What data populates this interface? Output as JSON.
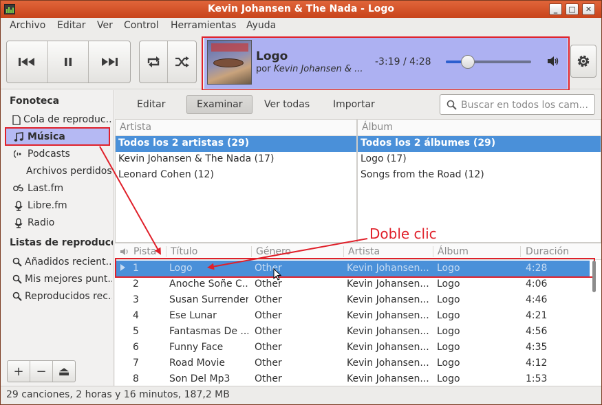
{
  "window": {
    "title": "Kevin Johansen & The Nada - Logo",
    "controls": [
      "_",
      "□",
      "✕"
    ]
  },
  "menu": [
    "Archivo",
    "Editar",
    "Ver",
    "Control",
    "Herramientas",
    "Ayuda"
  ],
  "now_playing": {
    "title": "Logo",
    "by_prefix": "por",
    "artist": "Kevin Johansen & ...",
    "time": "-3:19 / 4:28",
    "progress_fraction": 0.26
  },
  "sidebar": {
    "library_header": "Fonoteca",
    "items": [
      {
        "label": "Cola de reproduc...",
        "icon": "document-icon"
      },
      {
        "label": "Música",
        "icon": "music-note-icon",
        "selected": true
      },
      {
        "label": "Podcasts",
        "icon": "podcast-icon"
      },
      {
        "label": "Archivos perdidos",
        "icon": ""
      },
      {
        "label": "Last.fm",
        "icon": "lastfm-icon"
      },
      {
        "label": "Libre.fm",
        "icon": "librefm-icon"
      },
      {
        "label": "Radio",
        "icon": "radio-icon"
      }
    ],
    "playlists_header": "Listas de reproducció",
    "playlists": [
      {
        "label": "Añadidos recient...",
        "icon": "search-icon"
      },
      {
        "label": "Mis mejores punt...",
        "icon": "search-icon"
      },
      {
        "label": "Reproducidos rec...",
        "icon": "search-icon"
      }
    ],
    "bottom_buttons": [
      "+",
      "−",
      "⏏"
    ]
  },
  "browser": {
    "tabs": [
      "Editar",
      "Examinar",
      "Ver todas",
      "Importar"
    ],
    "active_tab": "Examinar",
    "search_placeholder": "Buscar en todos los cam...",
    "artist_header": "Artista",
    "artists": [
      "Todos los 2 artistas (29)",
      "Kevin Johansen & The Nada (17)",
      "Leonard Cohen (12)"
    ],
    "album_header": "Álbum",
    "albums": [
      "Todos los 2 álbumes (29)",
      "Logo (17)",
      "Songs from the Road (12)"
    ]
  },
  "tracks": {
    "columns": [
      "Pista",
      "Título",
      "Género",
      "Artista",
      "Álbum",
      "Duración"
    ],
    "rows": [
      {
        "track": "1",
        "title": "Logo",
        "genre": "Other",
        "artist": "Kevin Johansen...",
        "album": "Logo",
        "duration": "4:28",
        "playing": true
      },
      {
        "track": "2",
        "title": "Anoche Soñe C...",
        "genre": "Other",
        "artist": "Kevin Johansen...",
        "album": "Logo",
        "duration": "4:06"
      },
      {
        "track": "3",
        "title": "Susan Surrender",
        "genre": "Other",
        "artist": "Kevin Johansen...",
        "album": "Logo",
        "duration": "4:46"
      },
      {
        "track": "4",
        "title": "Ese Lunar",
        "genre": "Other",
        "artist": "Kevin Johansen...",
        "album": "Logo",
        "duration": "4:21"
      },
      {
        "track": "5",
        "title": "Fantasmas De ...",
        "genre": "Other",
        "artist": "Kevin Johansen...",
        "album": "Logo",
        "duration": "4:56"
      },
      {
        "track": "6",
        "title": "Funny Face",
        "genre": "Other",
        "artist": "Kevin Johansen...",
        "album": "Logo",
        "duration": "4:35"
      },
      {
        "track": "7",
        "title": "Road Movie",
        "genre": "Other",
        "artist": "Kevin Johansen...",
        "album": "Logo",
        "duration": "4:12"
      },
      {
        "track": "8",
        "title": "Son Del Mp3",
        "genre": "Other",
        "artist": "Kevin Johansen...",
        "album": "Logo",
        "duration": "1:53"
      }
    ]
  },
  "status": "29 canciones, 2 horas y 16 minutos, 187,2 MB",
  "annotation": {
    "text": "Doble clic",
    "color": "#e0202a"
  },
  "colors": {
    "titlebar": "#d4522a",
    "selection": "#4a90d9",
    "highlight": "#adb1f2",
    "annotation": "#e0202a"
  }
}
